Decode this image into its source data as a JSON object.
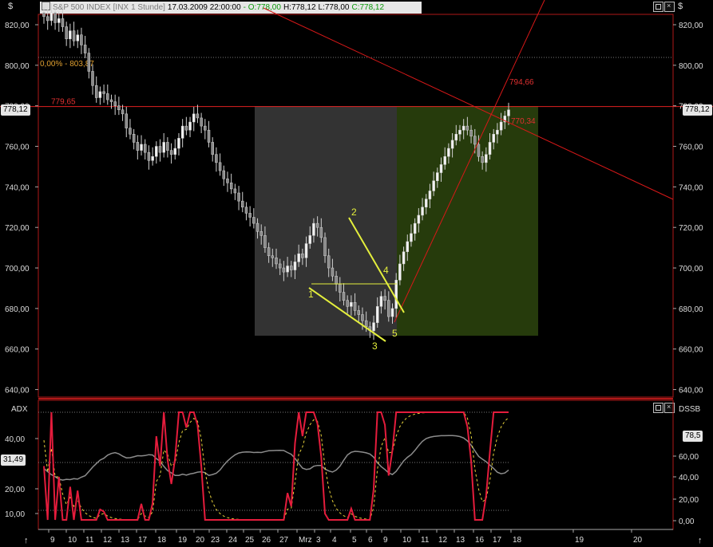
{
  "header": {
    "currency": "$",
    "instrument": "S&P 500 INDEX",
    "exchange": "[INX",
    "interval": "1 Stunde]",
    "datetime": "17.03.2009 22:00:00",
    "open": "- O:778,00",
    "high": "H:778,12",
    "low": "L:778,00",
    "close": "C:778,12"
  },
  "price_axis": {
    "labels": [
      "820,00",
      "800,00",
      "780,00",
      "760,00",
      "740,00",
      "720,00",
      "700,00",
      "680,00",
      "660,00",
      "640,00"
    ],
    "current_tag": "778,12"
  },
  "indicator": {
    "left_label": "ADX",
    "right_label": "DSSB",
    "left_axis_labels": [
      "40,00",
      "20,00",
      "10,00"
    ],
    "right_axis_labels": [
      "60,00",
      "40,00",
      "20,00",
      "0,00"
    ],
    "left_value_tag": "31,49",
    "right_value_tag": "78,5",
    "colors": {
      "adx": "#8c8c8c",
      "dss": "#e41c3c",
      "signal": "#e8d23c"
    }
  },
  "time_axis": {
    "labels": [
      "9",
      "10",
      "11",
      "12",
      "13",
      "17",
      "18",
      "19",
      "20",
      "23",
      "24",
      "25",
      "26",
      "27",
      "Mrz",
      "3",
      "4",
      "5",
      "6",
      "9",
      "10",
      "11",
      "12",
      "13",
      "16",
      "17",
      "18",
      "19",
      "20"
    ]
  },
  "annotations": {
    "fib_label": "0,00% - 803,87",
    "hline_label": "779,65",
    "line_label_1": "794,66",
    "line_label_2": "770,34",
    "waves": [
      "1",
      "2",
      "3",
      "4",
      "5"
    ]
  },
  "colors": {
    "accent": "#e4ef3c",
    "trend": "#d81818",
    "zone_left": "#333333",
    "zone_right": "#263b0c"
  },
  "chart_data": {
    "type": "candlestick",
    "ylim": [
      630,
      830
    ],
    "hourly_closes": [
      824,
      822,
      826,
      821,
      823,
      819,
      813,
      817,
      812,
      815,
      810,
      806,
      797,
      790,
      784,
      787,
      786,
      783,
      782,
      780,
      778,
      776,
      769,
      766,
      762,
      758,
      761,
      757,
      753,
      755,
      760,
      757,
      762,
      758,
      756,
      759,
      764,
      770,
      768,
      772,
      776,
      774,
      770,
      768,
      762,
      756,
      752,
      748,
      744,
      742,
      739,
      737,
      733,
      730,
      727,
      725,
      722,
      718,
      716,
      710,
      706,
      705,
      702,
      700,
      698,
      701,
      699,
      703,
      707,
      705,
      712,
      716,
      722,
      720,
      715,
      706,
      700,
      696,
      692,
      688,
      684,
      681,
      683,
      679,
      677,
      674,
      671,
      669,
      673,
      681,
      686,
      684,
      676,
      680,
      694,
      702,
      708,
      713,
      717,
      722,
      726,
      730,
      734,
      738,
      743,
      747,
      751,
      755,
      759,
      763,
      766,
      768,
      770,
      768,
      765,
      761,
      755,
      752,
      756,
      762,
      766,
      768,
      772,
      775,
      778
    ],
    "waves": [
      {
        "label": "1",
        "price": 691
      },
      {
        "label": "2",
        "price": 725
      },
      {
        "label": "3",
        "price": 663
      },
      {
        "label": "4",
        "price": 689
      },
      {
        "label": "5",
        "price": 674
      }
    ],
    "hline": 779.65,
    "fib_level": 803.87
  }
}
